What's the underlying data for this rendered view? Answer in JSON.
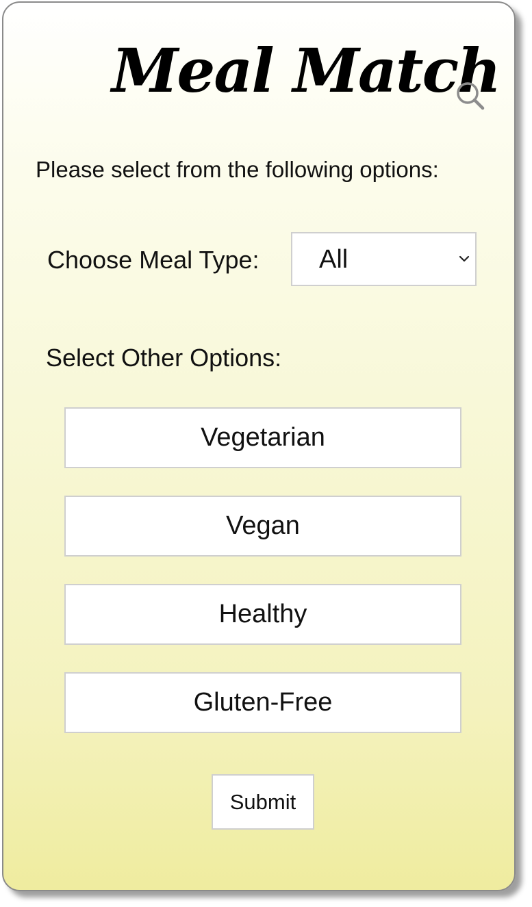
{
  "app": {
    "title": "Meal Match",
    "search_icon": "search-icon"
  },
  "form": {
    "prompt": "Please select from the following options:",
    "meal_type_label": "Choose Meal Type:",
    "meal_type_selected": "All",
    "other_options_label": "Select Other Options:",
    "options": [
      {
        "label": "Vegetarian"
      },
      {
        "label": "Vegan"
      },
      {
        "label": "Healthy"
      },
      {
        "label": "Gluten-Free"
      }
    ],
    "submit_label": "Submit"
  },
  "colors": {
    "background_top": "#ffffff",
    "background_bottom": "#efec9f",
    "border": "#cfcfcf",
    "text": "#111111",
    "icon": "#8c8c8c"
  }
}
